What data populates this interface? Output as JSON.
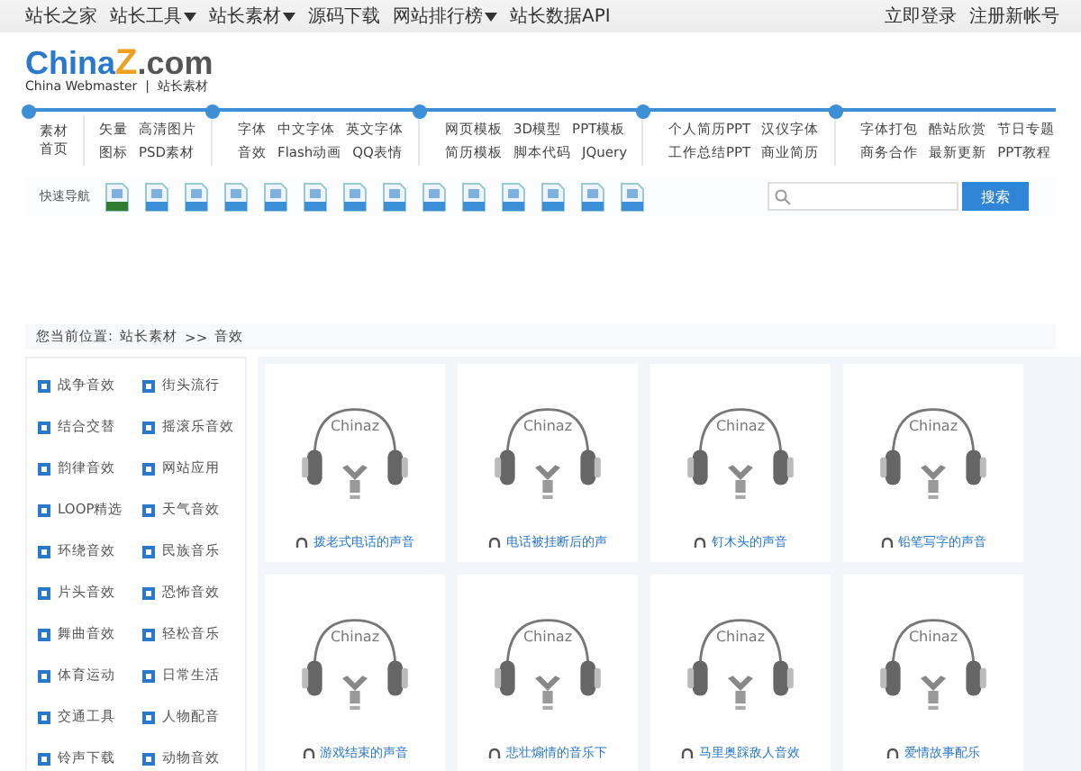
{
  "top_bar": {
    "links": [
      {
        "label": "站长之家",
        "dropdown": false
      },
      {
        "label": "站长工具",
        "dropdown": true
      },
      {
        "label": "站长素材",
        "dropdown": true
      },
      {
        "label": "源码下载",
        "dropdown": false
      },
      {
        "label": "网站排行榜",
        "dropdown": true
      },
      {
        "label": "站长数据API",
        "dropdown": false
      }
    ],
    "account": [
      "立即登录",
      "注册新帐号"
    ]
  },
  "logo": {
    "name_a": "China",
    "name_z": "Z",
    "name_b": ".com",
    "tagline": "China Webmaster  |  站长素材"
  },
  "nav": {
    "home": [
      "素材",
      "首页"
    ],
    "groups": [
      {
        "rows": [
          [
            "矢量",
            "高清图片"
          ],
          [
            "图标",
            "PSD素材"
          ]
        ]
      },
      {
        "rows": [
          [
            "字体",
            "中文字体",
            "英文字体"
          ],
          [
            "音效",
            "Flash动画",
            "QQ表情"
          ]
        ]
      },
      {
        "rows": [
          [
            "网页模板",
            "3D模型",
            "PPT模板"
          ],
          [
            "简历模板",
            "脚本代码",
            "JQuery"
          ]
        ]
      },
      {
        "rows": [
          [
            "个人简历PPT",
            "汉仪字体"
          ],
          [
            "工作总结PPT",
            "商业简历"
          ]
        ]
      },
      {
        "rows": [
          [
            "字体打包",
            "酷站欣赏",
            "节日专题"
          ],
          [
            "商务合作",
            "最新更新",
            "PPT教程"
          ]
        ]
      }
    ]
  },
  "quick_nav": {
    "label": "快速导航",
    "icons": [
      {
        "color": "#2e7d32"
      },
      {
        "color": "#3a8fd8"
      },
      {
        "color": "#3a8fd8"
      },
      {
        "color": "#3a8fd8"
      },
      {
        "color": "#3a8fd8"
      },
      {
        "color": "#3a8fd8"
      },
      {
        "color": "#3a8fd8"
      },
      {
        "color": "#3a8fd8"
      },
      {
        "color": "#3a8fd8"
      },
      {
        "color": "#3a8fd8"
      },
      {
        "color": "#3a8fd8"
      },
      {
        "color": "#3a8fd8"
      },
      {
        "color": "#3a8fd8"
      },
      {
        "color": "#3a8fd8"
      }
    ]
  },
  "search": {
    "button": "搜索"
  },
  "breadcrumb": {
    "prefix": "您当前位置:",
    "links": [
      "站长素材"
    ],
    "separator": ">>",
    "current": "音效"
  },
  "sidebar": {
    "items": [
      "战争音效",
      "街头流行",
      "结合交替",
      "摇滚乐音效",
      "韵律音效",
      "网站应用",
      "LOOP精选",
      "天气音效",
      "环绕音效",
      "民族音乐",
      "片头音效",
      "恐怖音效",
      "舞曲音效",
      "轻松音乐",
      "体育运动",
      "日常生活",
      "交通工具",
      "人物配音",
      "铃声下载",
      "动物音效"
    ]
  },
  "cards": [
    {
      "thumb_text": "Chinaz",
      "title": "拨老式电话的声音"
    },
    {
      "thumb_text": "Chinaz",
      "title": "电话被挂断后的声"
    },
    {
      "thumb_text": "Chinaz",
      "title": "钉木头的声音"
    },
    {
      "thumb_text": "Chinaz",
      "title": "铅笔写字的声音"
    },
    {
      "thumb_text": "Chinaz",
      "title": "游戏结束的声音"
    },
    {
      "thumb_text": "Chinaz",
      "title": "悲壮煽情的音乐下"
    },
    {
      "thumb_text": "Chinaz",
      "title": "马里奥踩敌人音效"
    },
    {
      "thumb_text": "Chinaz",
      "title": "爱情故事配乐"
    }
  ]
}
